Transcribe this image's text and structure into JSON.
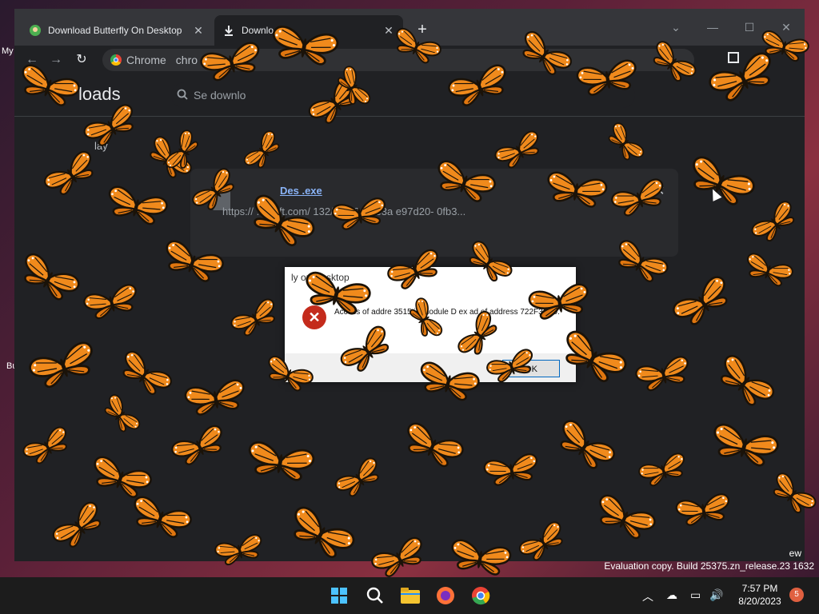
{
  "desktop": {
    "labels": [
      "My",
      "Bu"
    ]
  },
  "browser": {
    "tabs": [
      {
        "label": "Download Butterfly On Desktop",
        "icon": "butterfly-site-favicon",
        "close": "✕"
      },
      {
        "label": "Downlo",
        "icon": "download-icon",
        "close": "✕"
      }
    ],
    "new_tab": "+",
    "window_controls": {
      "minimize": "—",
      "maximize": "☐",
      "close": "✕",
      "tab_search": "⌄"
    },
    "omnibox": {
      "site_chip": "Chrome",
      "url": "chro"
    }
  },
  "downloads": {
    "title": "loads",
    "search_placeholder": "Se     downlo",
    "date_label": "lay",
    "item": {
      "filename": "Des          .exe",
      "url": "https://     .cdn        ft.com/     132/2bf86c8ce3a       e97d20-          0fb3..."
    }
  },
  "dialog": {
    "title": "ly on Desktop",
    "message": "Access       of addre       3515 in module            D        ex      ad of address 722F3C20.",
    "ok_label": "OK"
  },
  "watermark": {
    "line1": "ew",
    "line2": "Evaluation copy. Build 25375.zn_release.23      1632"
  },
  "taskbar": {
    "time": "7:57 PM",
    "date": "8/20/2023",
    "notification_count": "5"
  },
  "colors": {
    "butterfly_orange": "#f08a1c",
    "butterfly_black": "#1a1208",
    "chrome_dark": "#202124",
    "link_blue": "#8ab4f8"
  }
}
